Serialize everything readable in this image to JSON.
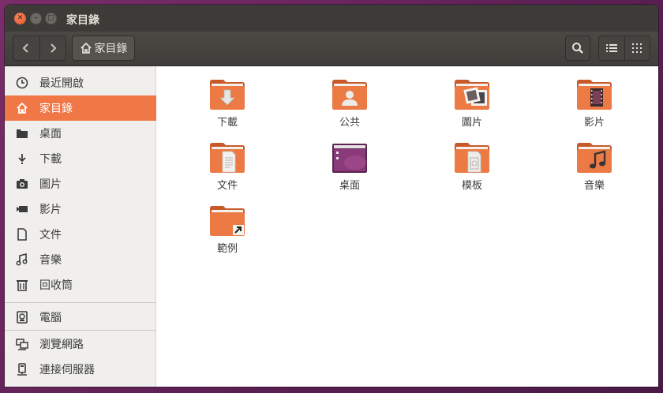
{
  "window": {
    "title": "家目錄"
  },
  "toolbar": {
    "path_label": "家目錄",
    "icons": [
      "back-arrow-icon",
      "forward-arrow-icon",
      "home-icon",
      "search-icon",
      "list-view-icon",
      "grid-view-icon"
    ]
  },
  "sidebar": {
    "items": [
      {
        "label": "最近開啟",
        "icon": "clock-icon"
      },
      {
        "label": "家目錄",
        "icon": "home-icon",
        "active": true
      },
      {
        "label": "桌面",
        "icon": "desktop-folder-icon"
      },
      {
        "label": "下載",
        "icon": "download-arrow-icon"
      },
      {
        "label": "圖片",
        "icon": "camera-icon"
      },
      {
        "label": "影片",
        "icon": "video-camera-icon"
      },
      {
        "label": "文件",
        "icon": "document-icon"
      },
      {
        "label": "音樂",
        "icon": "music-note-icon"
      },
      {
        "label": "回收筒",
        "icon": "trash-icon"
      },
      {
        "label": "電腦",
        "icon": "hard-drive-icon"
      },
      {
        "label": "瀏覽網路",
        "icon": "network-icon"
      },
      {
        "label": "連接伺服器",
        "icon": "server-icon"
      }
    ]
  },
  "files": [
    {
      "label": "下載",
      "icon": "downloads-folder-icon"
    },
    {
      "label": "公共",
      "icon": "public-folder-icon"
    },
    {
      "label": "圖片",
      "icon": "pictures-folder-icon"
    },
    {
      "label": "影片",
      "icon": "videos-folder-icon"
    },
    {
      "label": "文件",
      "icon": "documents-folder-icon"
    },
    {
      "label": "桌面",
      "icon": "desktop-folder-icon"
    },
    {
      "label": "模板",
      "icon": "templates-folder-icon"
    },
    {
      "label": "音樂",
      "icon": "music-folder-icon"
    },
    {
      "label": "範例",
      "icon": "examples-link-folder-icon"
    }
  ],
  "colors": {
    "accent": "#f07746",
    "titlebar": "#3c3b37",
    "folder_orange": "#e86a35",
    "desktop_purple": "#8a3a7a"
  }
}
